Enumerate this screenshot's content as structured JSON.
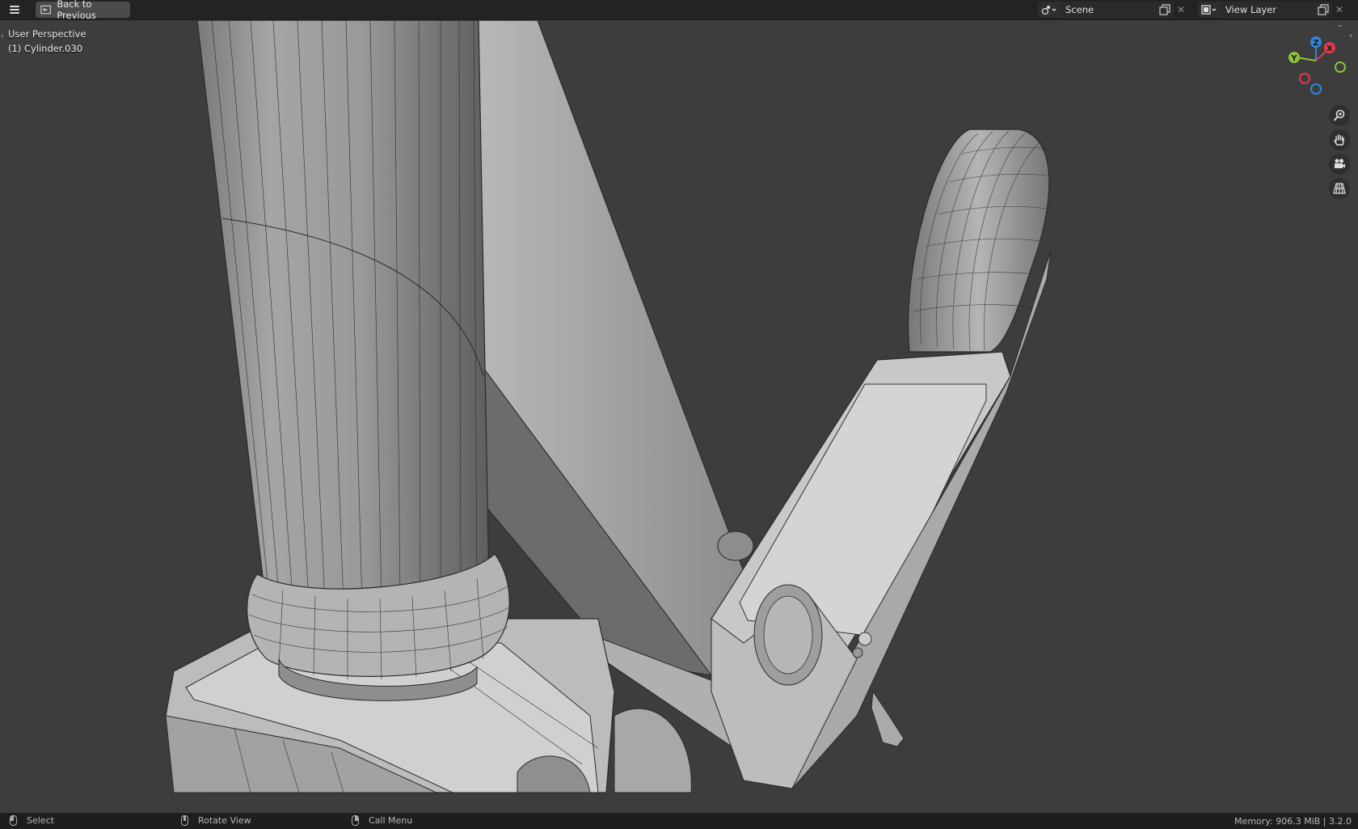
{
  "topbar": {
    "menu_icon": "hamburger-menu-icon",
    "back_label": "Back to Previous",
    "scene_name": "Scene",
    "view_layer_name": "View Layer"
  },
  "viewport": {
    "perspective_label": "User Perspective",
    "object_label": "(1) Cylinder.030",
    "gizmo_axes": [
      "X",
      "Y",
      "Z"
    ],
    "axis_colors": {
      "x": "#e2394f",
      "y": "#8bc23a",
      "z": "#2f86e0"
    },
    "nav_icons": [
      "zoom-icon",
      "pan-hand-icon",
      "camera-icon",
      "ortho-grid-icon"
    ]
  },
  "statusbar": {
    "select_label": "Select",
    "rotate_label": "Rotate View",
    "menu_label": "Call Menu",
    "memory_label": "Memory: 906.3 MiB | 3.2.0"
  }
}
